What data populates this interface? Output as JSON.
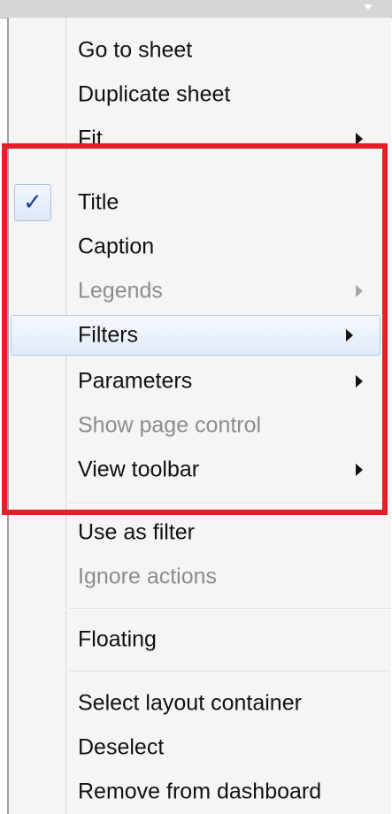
{
  "menu": {
    "items": [
      {
        "label": "Go to sheet",
        "submenu": false,
        "disabled": false
      },
      {
        "label": "Duplicate sheet",
        "submenu": false,
        "disabled": false
      },
      {
        "label": "Fit",
        "submenu": true,
        "disabled": false
      },
      {
        "label": "Title",
        "submenu": false,
        "disabled": false,
        "checked": true
      },
      {
        "label": "Caption",
        "submenu": false,
        "disabled": false
      },
      {
        "label": "Legends",
        "submenu": true,
        "disabled": true
      },
      {
        "label": "Filters",
        "submenu": true,
        "disabled": false,
        "hovered": true
      },
      {
        "label": "Parameters",
        "submenu": true,
        "disabled": false
      },
      {
        "label": "Show page control",
        "submenu": false,
        "disabled": true
      },
      {
        "label": "View toolbar",
        "submenu": true,
        "disabled": false
      },
      {
        "label": "Use as filter",
        "submenu": false,
        "disabled": false
      },
      {
        "label": "Ignore actions",
        "submenu": false,
        "disabled": true
      },
      {
        "label": "Floating",
        "submenu": false,
        "disabled": false
      },
      {
        "label": "Select layout container",
        "submenu": false,
        "disabled": false
      },
      {
        "label": "Deselect",
        "submenu": false,
        "disabled": false
      },
      {
        "label": "Remove from dashboard",
        "submenu": false,
        "disabled": false
      }
    ],
    "check_glyph": "✓"
  },
  "colors": {
    "highlight_border": "#e41e2a",
    "hover_background": "#e1ebf8",
    "disabled_text": "#8d8d8d",
    "checkmark": "#1a3b8f"
  },
  "icons": {
    "checkmark": "checkmark-icon",
    "submenu": "chevron-right-icon",
    "dropdown": "chevron-down-icon"
  }
}
